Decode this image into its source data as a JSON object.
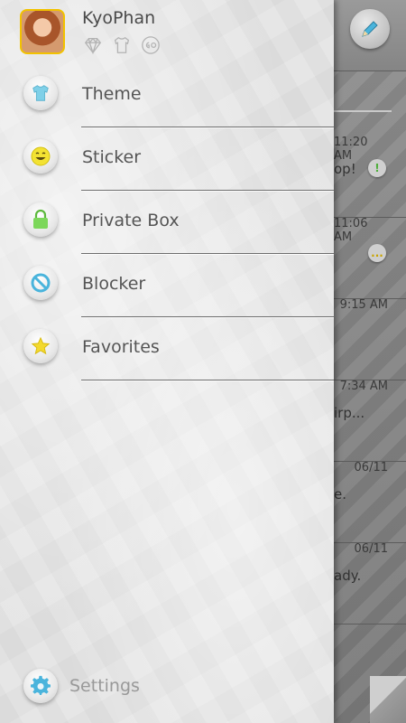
{
  "profile": {
    "username": "KyoPhan",
    "badges": [
      "diamond-icon",
      "shirt-icon",
      "go-icon"
    ]
  },
  "menu": [
    {
      "label": "Theme",
      "icon": "shirt-icon",
      "color": "#7fd0e8"
    },
    {
      "label": "Sticker",
      "icon": "smiley-icon",
      "color": "#f3e233"
    },
    {
      "label": "Private Box",
      "icon": "lock-icon",
      "color": "#7cd75a"
    },
    {
      "label": "Blocker",
      "icon": "block-icon",
      "color": "#4ab4dc"
    },
    {
      "label": "Favorites",
      "icon": "star-icon",
      "color": "#f3d92e"
    }
  ],
  "settings": {
    "label": "Settings",
    "icon": "gear-icon",
    "color": "#4ab4dc"
  },
  "background_list": {
    "rows": [
      {
        "time": "11:20 AM",
        "snippet": "op!",
        "badge": "!"
      },
      {
        "time": "11:06 AM",
        "snippet": "",
        "badge": "..."
      },
      {
        "time": "9:15 AM",
        "snippet": "",
        "badge": ""
      },
      {
        "time": "7:34 AM",
        "snippet": "irp...",
        "badge": ""
      },
      {
        "time": "06/11",
        "snippet": "e.",
        "badge": ""
      },
      {
        "time": "06/11",
        "snippet": "ady.",
        "badge": ""
      }
    ]
  }
}
